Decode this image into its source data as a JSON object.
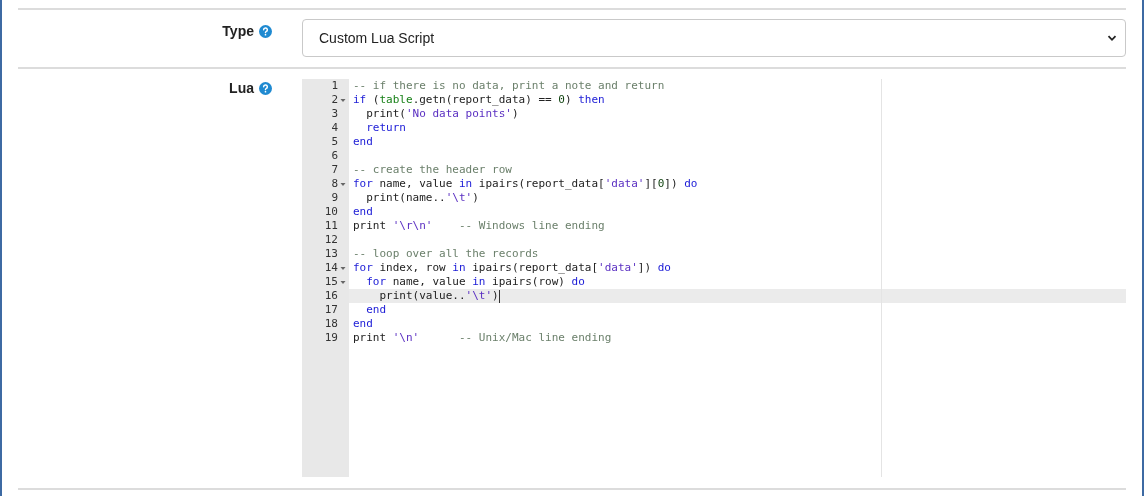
{
  "fields": [
    {
      "kind": "select",
      "label": "Type",
      "value": "Custom Lua Script"
    },
    {
      "kind": "code",
      "label": "Lua",
      "lines": [
        {
          "number": "1",
          "foldable": false,
          "active": false,
          "tokens": [
            {
              "kind": "comment",
              "text": "-- if there is no data, print a note and return"
            }
          ]
        },
        {
          "number": "2",
          "foldable": true,
          "active": false,
          "tokens": [
            {
              "kind": "keyword",
              "text": "if"
            },
            {
              "kind": "plain",
              "text": " ("
            },
            {
              "kind": "builtin",
              "text": "table"
            },
            {
              "kind": "plain",
              "text": ".getn(report_data) == "
            },
            {
              "kind": "number",
              "text": "0"
            },
            {
              "kind": "plain",
              "text": ") "
            },
            {
              "kind": "keyword",
              "text": "then"
            }
          ]
        },
        {
          "number": "3",
          "foldable": false,
          "active": false,
          "tokens": [
            {
              "kind": "plain",
              "text": "  print("
            },
            {
              "kind": "string",
              "text": "'No data points'"
            },
            {
              "kind": "plain",
              "text": ")"
            }
          ]
        },
        {
          "number": "4",
          "foldable": false,
          "active": false,
          "tokens": [
            {
              "kind": "keyword",
              "text": "  return"
            }
          ]
        },
        {
          "number": "5",
          "foldable": false,
          "active": false,
          "tokens": [
            {
              "kind": "keyword",
              "text": "end"
            }
          ]
        },
        {
          "number": "6",
          "foldable": false,
          "active": false
        },
        {
          "number": "7",
          "foldable": false,
          "active": false,
          "tokens": [
            {
              "kind": "comment",
              "text": "-- create the header row"
            }
          ]
        },
        {
          "number": "8",
          "foldable": true,
          "active": false,
          "tokens": [
            {
              "kind": "keyword",
              "text": "for"
            },
            {
              "kind": "plain",
              "text": " name, value "
            },
            {
              "kind": "keyword",
              "text": "in"
            },
            {
              "kind": "plain",
              "text": " ipairs(report_data["
            },
            {
              "kind": "string",
              "text": "'data'"
            },
            {
              "kind": "plain",
              "text": "]["
            },
            {
              "kind": "number",
              "text": "0"
            },
            {
              "kind": "plain",
              "text": "]) "
            },
            {
              "kind": "keyword",
              "text": "do"
            }
          ]
        },
        {
          "number": "9",
          "foldable": false,
          "active": false,
          "tokens": [
            {
              "kind": "plain",
              "text": "  print(name.."
            },
            {
              "kind": "string",
              "text": "'\\t'"
            },
            {
              "kind": "plain",
              "text": ")"
            }
          ]
        },
        {
          "number": "10",
          "foldable": false,
          "active": false,
          "tokens": [
            {
              "kind": "keyword",
              "text": "end"
            }
          ]
        },
        {
          "number": "11",
          "foldable": false,
          "active": false,
          "tokens": [
            {
              "kind": "plain",
              "text": "print "
            },
            {
              "kind": "string",
              "text": "'\\r\\n'"
            },
            {
              "kind": "comment",
              "text": "    -- Windows line ending"
            }
          ]
        },
        {
          "number": "12",
          "foldable": false,
          "active": false
        },
        {
          "number": "13",
          "foldable": false,
          "active": false,
          "tokens": [
            {
              "kind": "comment",
              "text": "-- loop over all the records"
            }
          ]
        },
        {
          "number": "14",
          "foldable": true,
          "active": false,
          "tokens": [
            {
              "kind": "keyword",
              "text": "for"
            },
            {
              "kind": "plain",
              "text": " index, row "
            },
            {
              "kind": "keyword",
              "text": "in"
            },
            {
              "kind": "plain",
              "text": " ipairs(report_data["
            },
            {
              "kind": "string",
              "text": "'data'"
            },
            {
              "kind": "plain",
              "text": "]) "
            },
            {
              "kind": "keyword",
              "text": "do"
            }
          ]
        },
        {
          "number": "15",
          "foldable": true,
          "active": false,
          "tokens": [
            {
              "kind": "keyword",
              "text": "  for"
            },
            {
              "kind": "plain",
              "text": " name, value "
            },
            {
              "kind": "keyword",
              "text": "in"
            },
            {
              "kind": "plain",
              "text": " ipairs(row) "
            },
            {
              "kind": "keyword",
              "text": "do"
            }
          ]
        },
        {
          "number": "16",
          "foldable": false,
          "active": true,
          "tokens": [
            {
              "kind": "plain",
              "text": "    print(value.."
            },
            {
              "kind": "string",
              "text": "'\\t'"
            },
            {
              "kind": "plain",
              "text": ")"
            }
          ]
        },
        {
          "number": "17",
          "foldable": false,
          "active": false,
          "tokens": [
            {
              "kind": "keyword",
              "text": "  end"
            }
          ]
        },
        {
          "number": "18",
          "foldable": false,
          "active": false,
          "tokens": [
            {
              "kind": "keyword",
              "text": "end"
            }
          ]
        },
        {
          "number": "19",
          "foldable": false,
          "active": false,
          "tokens": [
            {
              "kind": "plain",
              "text": "print "
            },
            {
              "kind": "string",
              "text": "'\\n'"
            },
            {
              "kind": "comment",
              "text": "      -- Unix/Mac line ending"
            }
          ]
        }
      ]
    }
  ]
}
